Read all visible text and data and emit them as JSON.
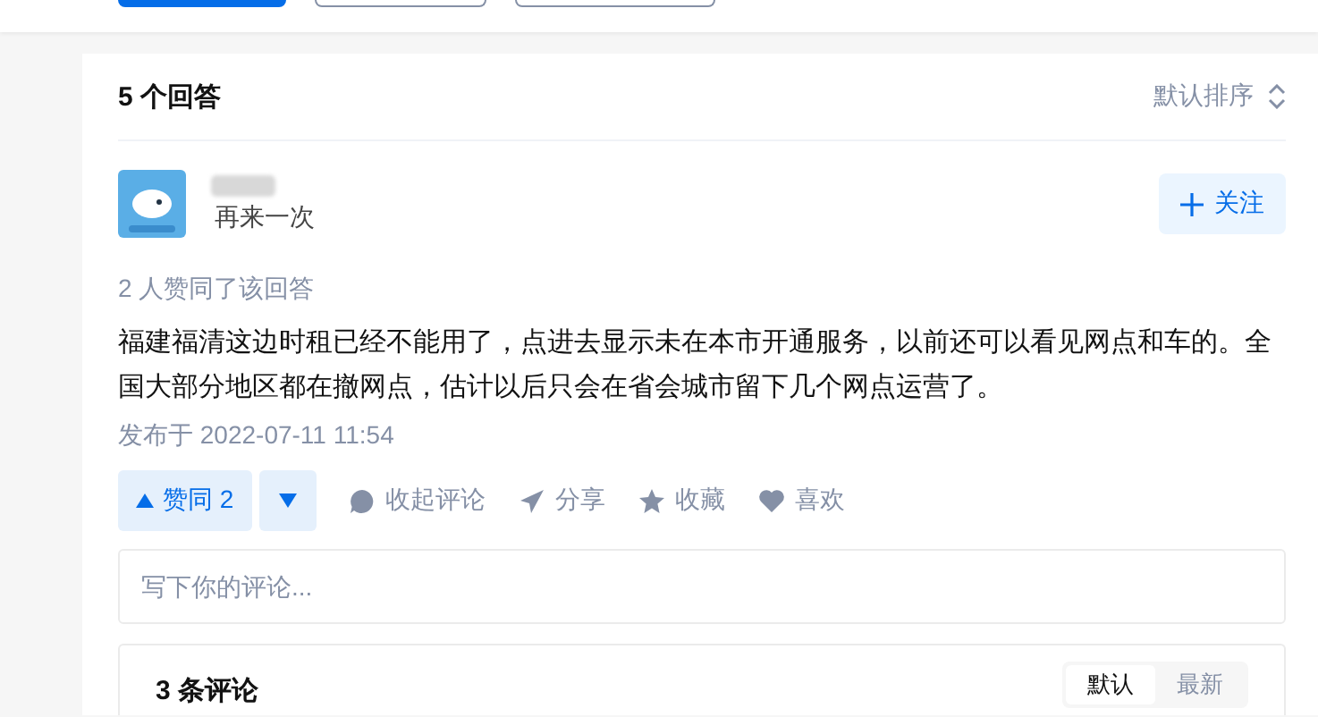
{
  "top_buttons": [
    {
      "kind": "primary"
    },
    {
      "kind": "outline"
    },
    {
      "kind": "outline"
    }
  ],
  "answers_header": {
    "title": "5 个回答",
    "sort": "默认排序"
  },
  "answer": {
    "author": {
      "subtitle": "再来一次"
    },
    "follow": "关注",
    "upvote_note": "2 人赞同了该回答",
    "text": "福建福清这边时租已经不能用了，点进去显示未在本市开通服务，以前还可以看见网点和车的。全国大部分地区都在撤网点，估计以后只会在省会城市留下几个网点运营了。",
    "date": "发布于 2022-07-11 11:54",
    "vote": {
      "label": "赞同 2"
    },
    "actions": [
      {
        "kind": "comment",
        "label": "收起评论"
      },
      {
        "kind": "share",
        "label": "分享"
      },
      {
        "kind": "favorite",
        "label": "收藏"
      },
      {
        "kind": "like",
        "label": "喜欢"
      }
    ],
    "comment_placeholder": "写下你的评论...",
    "comments": {
      "title": "3 条评论",
      "sort_tabs": [
        {
          "label": "默认",
          "selected": true
        },
        {
          "label": "最新",
          "selected": false
        }
      ]
    }
  }
}
